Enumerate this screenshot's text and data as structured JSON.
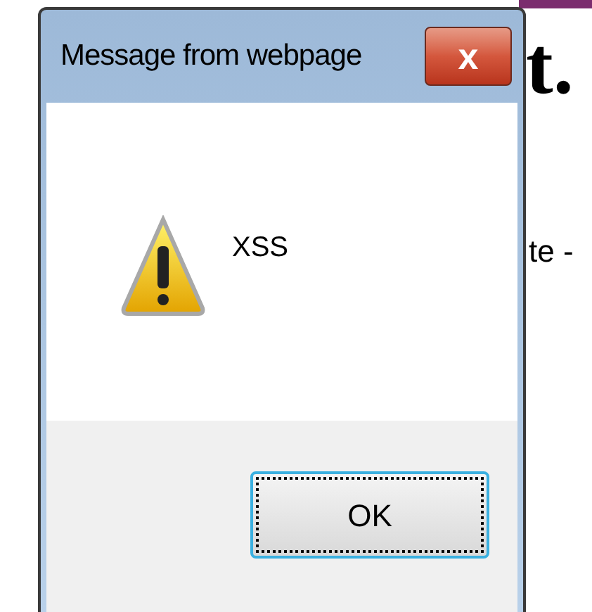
{
  "page": {
    "heading_fragment": "t.",
    "text_fragment": "te -"
  },
  "dialog": {
    "title": "Message from webpage",
    "close": "x",
    "message": "XSS",
    "buttons": [
      {
        "label": "OK",
        "focused": true
      }
    ]
  }
}
